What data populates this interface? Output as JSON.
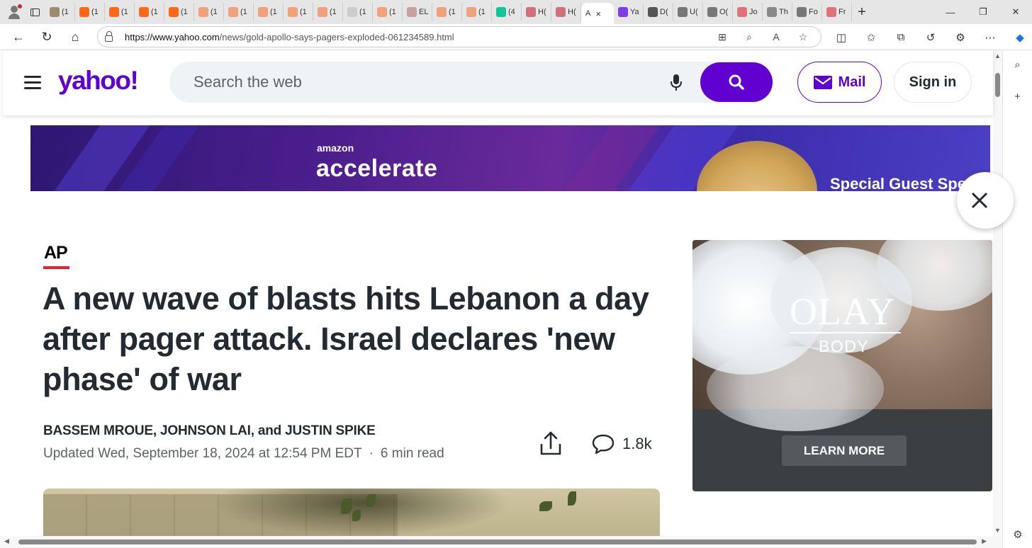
{
  "browser": {
    "tabs": [
      {
        "label": "(1",
        "icon": "avatar-photo",
        "color": "#9b8b70"
      },
      {
        "label": "(1",
        "icon": "substack",
        "color": "#ff6719"
      },
      {
        "label": "(1",
        "icon": "substack",
        "color": "#ff6719"
      },
      {
        "label": "(1",
        "icon": "substack",
        "color": "#ff6719"
      },
      {
        "label": "(1",
        "icon": "substack",
        "color": "#ff6719"
      },
      {
        "label": "(1",
        "icon": "substack",
        "color": "#f0a07a"
      },
      {
        "label": "(1",
        "icon": "substack",
        "color": "#f0a07a"
      },
      {
        "label": "(1",
        "icon": "substack",
        "color": "#f0a07a"
      },
      {
        "label": "(1",
        "icon": "substack",
        "color": "#f0a07a"
      },
      {
        "label": "(1",
        "icon": "substack",
        "color": "#f0a07a"
      },
      {
        "label": "(1",
        "icon": "search",
        "color": "#cccccc"
      },
      {
        "label": "(1",
        "icon": "substack",
        "color": "#f0a07a"
      },
      {
        "label": "EL",
        "icon": "eye",
        "color": "#c8a0a0"
      },
      {
        "label": "(1",
        "icon": "substack",
        "color": "#f0a07a"
      },
      {
        "label": "(1",
        "icon": "substack",
        "color": "#f0a07a"
      },
      {
        "label": "(4",
        "icon": "grammarly",
        "color": "#15c39a"
      },
      {
        "label": "H(",
        "icon": "podcast",
        "color": "#d0707a"
      },
      {
        "label": "H(",
        "icon": "podcast",
        "color": "#d0707a"
      }
    ],
    "active_tab": {
      "label": "A",
      "close": "×"
    },
    "more_tabs": [
      {
        "label": "Ya",
        "icon": "yahoo",
        "color": "#7b3fe4"
      },
      {
        "label": "D(",
        "icon": "stripes",
        "color": "#555555"
      },
      {
        "label": "U(",
        "icon": "wikipedia",
        "color": "#777777"
      },
      {
        "label": "O(",
        "icon": "wikipedia",
        "color": "#777777"
      },
      {
        "label": "Jo",
        "icon": "youtube",
        "color": "#e0707a"
      },
      {
        "label": "Th",
        "icon": "arrow",
        "color": "#888888"
      },
      {
        "label": "Fo",
        "icon": "wikipedia",
        "color": "#777777"
      },
      {
        "label": "Fr",
        "icon": "youtube",
        "color": "#e0707a"
      }
    ],
    "url_host": "https://www.yahoo.com",
    "url_path": "/news/gold-apollo-says-pagers-exploded-061234589.html"
  },
  "header": {
    "logo": "yahoo!",
    "search_placeholder": "Search the web",
    "mail_label": "Mail",
    "signin_label": "Sign in"
  },
  "top_ad": {
    "brand": "amazon",
    "title": "accelerate",
    "guest_text": "Special Guest Spe"
  },
  "article": {
    "source_logo": "AP",
    "headline": "A new wave of blasts hits Lebanon a day after pager attack. Israel declares 'new phase' of war",
    "authors": "BASSEM MROUE, JOHNSON LAI, and JUSTIN SPIKE",
    "updated": "Updated Wed, September 18, 2024 at 12:54 PM EDT",
    "separator": "·",
    "read_time": "6 min read",
    "comment_count": "1.8k"
  },
  "side_ad": {
    "brand": "OLAY",
    "sub": "BODY",
    "cta": "LEARN MORE"
  },
  "colors": {
    "yahoo_purple": "#6001d2",
    "ap_red": "#e8202a",
    "text_dark": "#232a31",
    "text_muted": "#5b636a"
  }
}
